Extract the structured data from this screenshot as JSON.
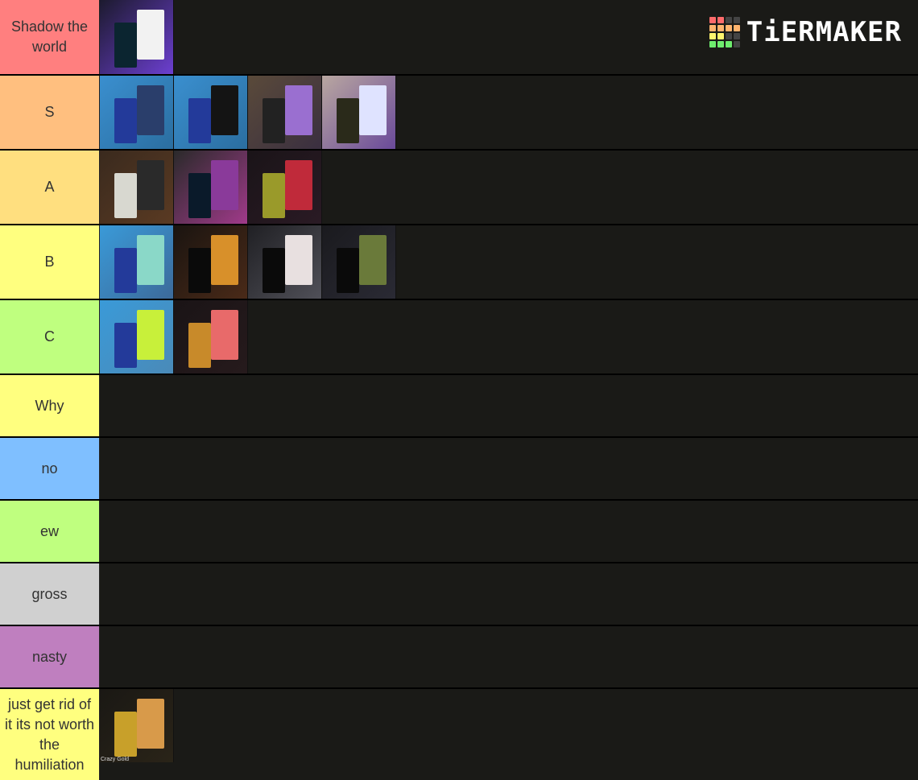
{
  "app": {
    "brand": "TiERMAKER"
  },
  "logo": {
    "grid_colors": [
      "#ff6b6b",
      "#ff6b6b",
      "#444444",
      "#444444",
      "#ffb46e",
      "#ffb46e",
      "#ffb46e",
      "#ffb46e",
      "#fff56e",
      "#fff56e",
      "#444444",
      "#444444",
      "#6eed6e",
      "#6eed6e",
      "#6eed6e",
      "#444444"
    ]
  },
  "tiers": [
    {
      "label": "Shadow the world",
      "color": "#ff7f7f",
      "items": [
        {
          "name": "shadow-the-world-stand",
          "caption": "",
          "bg": [
            "#1c1a2e",
            "#6c3fd0"
          ],
          "fig": [
            "#0b2530",
            "#f2f2f2"
          ]
        }
      ]
    },
    {
      "label": "S",
      "color": "#ffbf7f",
      "items": [
        {
          "name": "s-item-1",
          "caption": "",
          "bg": [
            "#3a8fcf",
            "#2b6ea0"
          ],
          "fig": [
            "#233a9a",
            "#2a3e6b"
          ]
        },
        {
          "name": "s-item-2",
          "caption": "",
          "bg": [
            "#3a8fcf",
            "#2b6ea0"
          ],
          "fig": [
            "#233a9a",
            "#141414"
          ]
        },
        {
          "name": "s-item-3",
          "caption": "",
          "bg": [
            "#5a4a3a",
            "#3a2f40"
          ],
          "fig": [
            "#222222",
            "#9a6fd0"
          ]
        },
        {
          "name": "s-item-4",
          "caption": "",
          "bg": [
            "#b9a7a0",
            "#6a4a9a"
          ],
          "fig": [
            "#2a2a1a",
            "#dfe3ff"
          ]
        }
      ]
    },
    {
      "label": "A",
      "color": "#ffdf7f",
      "items": [
        {
          "name": "a-item-1",
          "caption": "",
          "bg": [
            "#3a2a1e",
            "#5a3a22"
          ],
          "fig": [
            "#d8d8d0",
            "#2a2a2a"
          ]
        },
        {
          "name": "a-item-2",
          "caption": "",
          "bg": [
            "#2a2a2a",
            "#a03a8a"
          ],
          "fig": [
            "#0a1a2a",
            "#8a3a9a"
          ]
        },
        {
          "name": "a-item-3",
          "caption": "",
          "bg": [
            "#1a1418",
            "#2a1a24"
          ],
          "fig": [
            "#9a9a2a",
            "#c02a3a"
          ]
        }
      ]
    },
    {
      "label": "B",
      "color": "#ffff7f",
      "items": [
        {
          "name": "b-item-1",
          "caption": "",
          "bg": [
            "#3a9ad8",
            "#3c6a9a"
          ],
          "fig": [
            "#233a9a",
            "#8ad8c8"
          ]
        },
        {
          "name": "b-item-2",
          "caption": "",
          "bg": [
            "#1a1410",
            "#4a2a18"
          ],
          "fig": [
            "#0a0a0a",
            "#d8902a"
          ]
        },
        {
          "name": "b-item-3",
          "caption": "",
          "bg": [
            "#202024",
            "#505058"
          ],
          "fig": [
            "#0a0a0a",
            "#e8e0e0"
          ]
        },
        {
          "name": "b-item-4",
          "caption": "",
          "bg": [
            "#1a1a1e",
            "#2a2a34"
          ],
          "fig": [
            "#0a0a0a",
            "#6a7a3a"
          ]
        }
      ]
    },
    {
      "label": "C",
      "color": "#bfff7f",
      "items": [
        {
          "name": "c-item-1",
          "caption": "",
          "bg": [
            "#3a9ad8",
            "#4a8ab8"
          ],
          "fig": [
            "#233a9a",
            "#c8f03a"
          ]
        },
        {
          "name": "c-item-2",
          "caption": "",
          "bg": [
            "#1a1416",
            "#261a1c"
          ],
          "fig": [
            "#c88a2a",
            "#e86a6a"
          ]
        }
      ]
    },
    {
      "label": "Why",
      "color": "#ffff7f",
      "items": []
    },
    {
      "label": "no",
      "color": "#7fbfff",
      "items": []
    },
    {
      "label": "ew",
      "color": "#bfff7f",
      "items": []
    },
    {
      "label": "gross",
      "color": "#d0d0d0",
      "items": []
    },
    {
      "label": "nasty",
      "color": "#bf7fbf",
      "items": []
    },
    {
      "label": "just get rid of it its not worth the humiliation",
      "color": "#ffff7f",
      "items": [
        {
          "name": "crazy-gold-stand",
          "caption": "Crazy Gold",
          "bg": [
            "#1a1814",
            "#2a2418"
          ],
          "fig": [
            "#c8a02a",
            "#d89a4a"
          ]
        }
      ]
    }
  ]
}
